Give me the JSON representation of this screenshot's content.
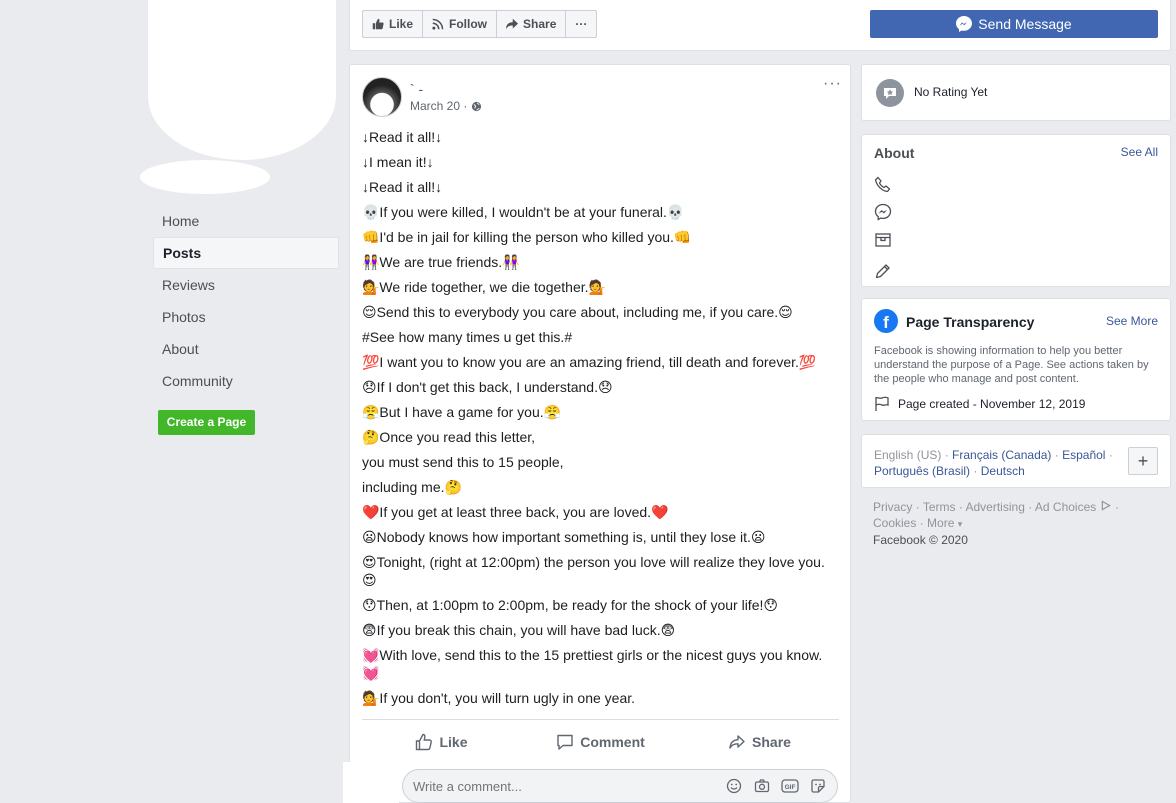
{
  "left_nav": {
    "items": [
      {
        "label": "Home",
        "active": false
      },
      {
        "label": "Posts",
        "active": true
      },
      {
        "label": "Reviews",
        "active": false
      },
      {
        "label": "Photos",
        "active": false
      },
      {
        "label": "About",
        "active": false
      },
      {
        "label": "Community",
        "active": false
      }
    ],
    "create_page_label": "Create a Page"
  },
  "top_actions": {
    "like": "Like",
    "follow": "Follow",
    "share": "Share",
    "more": "···",
    "send_message": "Send Message"
  },
  "post": {
    "author": "` -",
    "date": "March 20 ·",
    "more": "···",
    "lines": [
      "↓Read it all!↓",
      "↓I mean it!↓",
      "↓Read it all!↓",
      "💀If you were killed, I wouldn't be at your funeral.💀",
      "👊I'd be in jail for killing the person who killed you.👊",
      "👭We are true friends.👭",
      "💁We ride together, we die together.💁",
      "😌Send this to everybody you care about, including me, if you care.😌",
      "#See how many times u get this.#",
      "💯I want you to know you are an amazing friend, till death and forever.💯",
      "😞If I don't get this back, I understand.😞",
      "😤But I have a game for you.😤",
      "🤔Once you read this letter,",
      "you must send this to 15 people,",
      "including me.🤔",
      "❤️If you get at least three back, you are loved.❤️",
      "😦Nobody knows how important something is, until they lose it.😦",
      "😍Tonight, (right at 12:00pm) the person you love will realize they love you. 😍",
      "😯Then, at 1:00pm to 2:00pm, be ready for the shock of your life!😯",
      "😨If you break this chain, you will have bad luck.😨",
      "💓With love, send this to the 15 prettiest girls or the nicest guys you know. 💓",
      "💁If you don't, you will turn ugly in one year."
    ],
    "actions": {
      "like": "Like",
      "comment": "Comment",
      "share": "Share"
    },
    "comment_placeholder": "Write a comment...",
    "comment_gif": "GIF"
  },
  "right": {
    "rating": "No Rating Yet",
    "about_title": "About",
    "about_see_all": "See All",
    "transparency_title": "Page Transparency",
    "transparency_see_more": "See More",
    "transparency_desc": "Facebook is showing information to help you better understand the purpose of a Page. See actions taken by the people who manage and post content.",
    "page_created": "Page created - November 12, 2019",
    "languages": {
      "current": "English (US)",
      "others": [
        "Français (Canada)",
        "Español",
        "Português (Brasil)",
        "Deutsch"
      ],
      "sep": "·"
    },
    "plus": "+",
    "footer": {
      "links": [
        "Privacy",
        "Terms",
        "Advertising",
        "Ad Choices",
        "Cookies",
        "More"
      ],
      "sep": "·",
      "more_caret": "▾",
      "copyright": "Facebook © 2020"
    }
  }
}
